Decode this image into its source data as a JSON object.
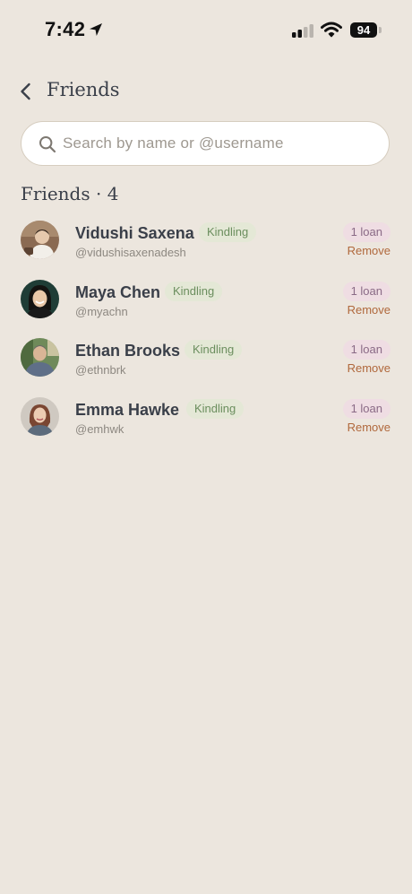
{
  "status_bar": {
    "time": "7:42",
    "battery": "94"
  },
  "header": {
    "title": "Friends"
  },
  "search": {
    "placeholder": "Search by name or @username",
    "value": ""
  },
  "section": {
    "heading": "Friends · 4"
  },
  "friends": [
    {
      "name": "Vidushi Saxena",
      "handle": "@vidushisaxenadesh",
      "tier": "Kindling",
      "loans": "1 loan",
      "remove_label": "Remove"
    },
    {
      "name": "Maya Chen",
      "handle": "@myachn",
      "tier": "Kindling",
      "loans": "1 loan",
      "remove_label": "Remove"
    },
    {
      "name": "Ethan Brooks",
      "handle": "@ethnbrk",
      "tier": "Kindling",
      "loans": "1 loan",
      "remove_label": "Remove"
    },
    {
      "name": "Emma Hawke",
      "handle": "@emhwk",
      "tier": "Kindling",
      "loans": "1 loan",
      "remove_label": "Remove"
    }
  ],
  "icons": {
    "back": "chevron-left-icon",
    "search": "search-icon",
    "location": "location-arrow-icon",
    "signal": "cellular-signal-icon",
    "wifi": "wifi-icon",
    "battery": "battery-icon"
  },
  "colors": {
    "background": "#ece6de",
    "tier_badge_bg": "#e4e8d6",
    "tier_badge_text": "#6b8e5e",
    "loan_badge_bg": "#efdde3",
    "loan_badge_text": "#8a6a86",
    "remove_text": "#b0683c"
  }
}
